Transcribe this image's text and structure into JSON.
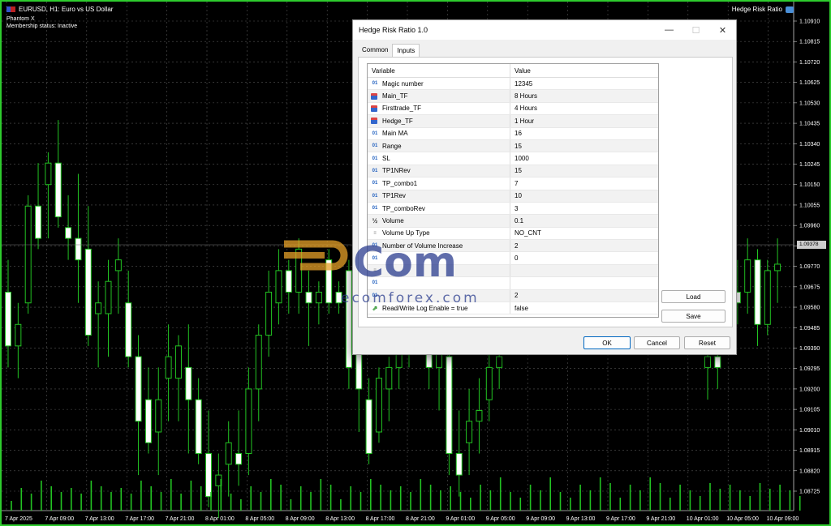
{
  "chart": {
    "symbol_title": "EURUSD, H1:  Euro vs US Dollar",
    "ea_name": "Phantom X",
    "membership": "Membership status: Inactive",
    "ea_label": "Hedge Risk Ratio",
    "current_price": "1.09378",
    "price_labels": [
      "1.10910",
      "1.10815",
      "1.10720",
      "1.10625",
      "1.10530",
      "1.10435",
      "1.10340",
      "1.10245",
      "1.10150",
      "1.10055",
      "1.09960",
      "1.09865",
      "1.09770",
      "1.09675",
      "1.09580",
      "1.09485",
      "1.09390",
      "1.09295",
      "1.09200",
      "1.09105",
      "1.09010",
      "1.08915",
      "1.08820",
      "1.08725"
    ],
    "time_labels": [
      "7 Apr 2025",
      "7 Apr 09:00",
      "7 Apr 13:00",
      "7 Apr 17:00",
      "7 Apr 21:00",
      "8 Apr 01:00",
      "8 Apr 05:00",
      "8 Apr 09:00",
      "8 Apr 13:00",
      "8 Apr 17:00",
      "8 Apr 21:00",
      "9 Apr 01:00",
      "9 Apr 05:00",
      "9 Apr 09:00",
      "9 Apr 13:00",
      "9 Apr 17:00",
      "9 Apr 21:00",
      "10 Apr 01:00",
      "10 Apr 05:00",
      "10 Apr 09:00"
    ],
    "candles": [
      [
        1.0965,
        1.098,
        1.093,
        1.094
      ],
      [
        1.094,
        1.096,
        1.0925,
        1.095
      ],
      [
        1.096,
        1.101,
        1.0955,
        1.1005
      ],
      [
        1.1005,
        1.1025,
        1.0985,
        1.099
      ],
      [
        1.1015,
        1.103,
        1.099,
        1.1025
      ],
      [
        1.1025,
        1.1045,
        1.0995,
        1.1
      ],
      [
        1.0995,
        1.101,
        1.098,
        1.099
      ],
      [
        1.099,
        1.102,
        1.096,
        1.098
      ],
      [
        1.0985,
        1.1005,
        1.094,
        1.0945
      ],
      [
        1.0955,
        1.097,
        1.093,
        1.096
      ],
      [
        1.0955,
        1.098,
        1.0935,
        1.097
      ],
      [
        1.0975,
        1.099,
        1.0955,
        1.098
      ],
      [
        1.096,
        1.0975,
        1.093,
        1.0935
      ],
      [
        1.0935,
        1.0945,
        1.088,
        1.0905
      ],
      [
        1.0915,
        1.093,
        1.089,
        1.0895
      ],
      [
        1.09,
        1.093,
        1.088,
        1.0915
      ],
      [
        1.0925,
        1.095,
        1.0905,
        1.0935
      ],
      [
        1.0925,
        1.0945,
        1.0905,
        1.094
      ],
      [
        1.093,
        1.095,
        1.089,
        1.0915
      ],
      [
        1.0915,
        1.0925,
        1.0885,
        1.089
      ],
      [
        1.089,
        1.091,
        1.0865,
        1.087
      ],
      [
        1.0875,
        1.089,
        1.086,
        1.088
      ],
      [
        1.0885,
        1.0905,
        1.087,
        1.0895
      ],
      [
        1.089,
        1.091,
        1.0875,
        1.0885
      ],
      [
        1.089,
        1.093,
        1.088,
        1.092
      ],
      [
        1.092,
        1.095,
        1.0905,
        1.0945
      ],
      [
        1.0945,
        1.0975,
        1.0935,
        1.0965
      ],
      [
        1.096,
        1.0985,
        1.095,
        1.0975
      ],
      [
        1.0975,
        1.098,
        1.0955,
        1.0965
      ],
      [
        1.0965,
        1.099,
        1.0955,
        1.0985
      ],
      [
        1.0965,
        1.0975,
        1.094,
        1.096
      ],
      [
        1.096,
        1.097,
        1.095,
        1.0965
      ],
      [
        1.098,
        1.0985,
        1.0955,
        1.096
      ],
      [
        1.0965,
        1.097,
        1.0955,
        1.096
      ],
      [
        1.0975,
        1.098,
        1.092,
        1.093
      ],
      [
        1.094,
        1.095,
        1.09,
        1.092
      ],
      [
        1.0915,
        1.0925,
        1.0885,
        1.089
      ],
      [
        1.09,
        1.093,
        1.0895,
        1.0925
      ],
      [
        1.092,
        1.0935,
        1.0905,
        1.093
      ],
      [
        1.093,
        1.095,
        1.092,
        1.0945
      ],
      [
        1.095,
        1.0965,
        1.093,
        1.0955
      ],
      [
        1.0955,
        1.0975,
        1.094,
        1.096
      ],
      [
        1.094,
        1.096,
        1.092,
        1.093
      ],
      [
        1.093,
        1.095,
        1.091,
        1.094
      ],
      [
        1.0935,
        1.0945,
        1.088,
        1.089
      ],
      [
        1.089,
        1.091,
        1.087,
        1.088
      ],
      [
        1.0895,
        1.092,
        1.088,
        1.0905
      ],
      [
        1.0905,
        1.0925,
        1.089,
        1.091
      ],
      [
        1.0915,
        1.094,
        1.0905,
        1.093
      ],
      [
        1.093,
        1.095,
        1.092,
        1.0935
      ]
    ],
    "late_candles": [
      [
        1.093,
        1.0945,
        1.0915,
        1.0935
      ],
      [
        1.0935,
        1.095,
        1.092,
        1.093
      ],
      [
        1.095,
        1.0975,
        1.094,
        1.0965
      ],
      [
        1.0965,
        1.098,
        1.095,
        1.096
      ],
      [
        1.0965,
        1.099,
        1.0955,
        1.098
      ],
      [
        1.098,
        1.0985,
        1.094,
        1.095
      ],
      [
        1.095,
        1.098,
        1.0945,
        1.0975
      ],
      [
        1.0975,
        1.099,
        1.096,
        1.0978
      ]
    ]
  },
  "dialog": {
    "title": "Hedge Risk Ratio 1.0",
    "tabs": [
      "Common",
      "Inputs"
    ],
    "active_tab": "Inputs",
    "header": {
      "variable": "Variable",
      "value": "Value"
    },
    "rows": [
      {
        "icon": "int-icon",
        "glyph": "01",
        "name": "Magic number",
        "value": "12345"
      },
      {
        "icon": "timeframe-icon",
        "glyph": "",
        "name": "Main_TF",
        "value": "8 Hours"
      },
      {
        "icon": "timeframe-icon",
        "glyph": "",
        "name": "Firsttrade_TF",
        "value": "4 Hours"
      },
      {
        "icon": "timeframe-icon",
        "glyph": "",
        "name": "Hedge_TF",
        "value": "1 Hour"
      },
      {
        "icon": "int-icon",
        "glyph": "01",
        "name": "Main MA",
        "value": "16"
      },
      {
        "icon": "int-icon",
        "glyph": "01",
        "name": "Range",
        "value": "15"
      },
      {
        "icon": "int-icon",
        "glyph": "01",
        "name": "SL",
        "value": "1000"
      },
      {
        "icon": "int-icon",
        "glyph": "01",
        "name": "TP1NRev",
        "value": "15"
      },
      {
        "icon": "int-icon",
        "glyph": "01",
        "name": "TP_combo1",
        "value": "7"
      },
      {
        "icon": "int-icon",
        "glyph": "01",
        "name": "TP1Rev",
        "value": "10"
      },
      {
        "icon": "int-icon",
        "glyph": "01",
        "name": "TP_comboRev",
        "value": "3"
      },
      {
        "icon": "double-icon",
        "glyph": "½",
        "name": "Volume",
        "value": "0.1"
      },
      {
        "icon": "enum-icon",
        "glyph": "≡",
        "name": "Volume Up Type",
        "value": "NO_CNT"
      },
      {
        "icon": "int-icon",
        "glyph": "01",
        "name": "Number of Volume Increase",
        "value": "2"
      },
      {
        "icon": "int-icon",
        "glyph": "01",
        "name": "",
        "value": "0"
      },
      {
        "icon": "enum-icon",
        "glyph": "≡",
        "name": "",
        "value": ""
      },
      {
        "icon": "int-icon",
        "glyph": "01",
        "name": "",
        "value": ""
      },
      {
        "icon": "int-icon",
        "glyph": "01",
        "name": "",
        "value": "2"
      },
      {
        "icon": "bool-icon",
        "glyph": "⇗",
        "name": "Read/Write Log Enable = true",
        "value": "false"
      }
    ],
    "buttons": {
      "load": "Load",
      "save": "Save",
      "ok": "OK",
      "cancel": "Cancel",
      "reset": "Reset"
    },
    "watermark": {
      "brand": "ecomforex.com",
      "logo_text": "Com"
    }
  }
}
